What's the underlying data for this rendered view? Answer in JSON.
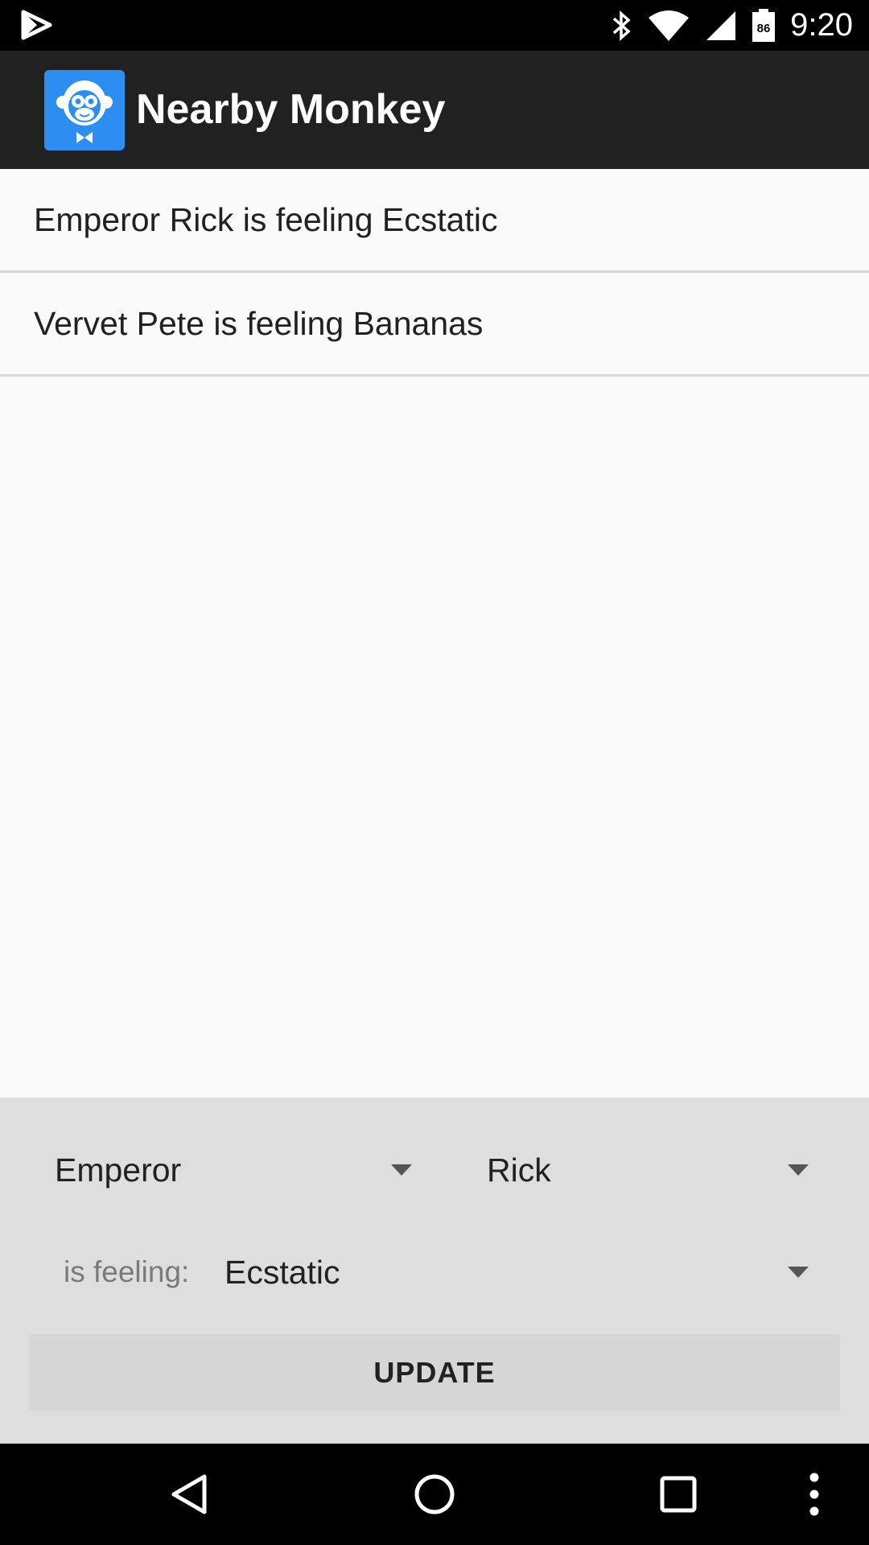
{
  "status_bar": {
    "time": "9:20",
    "battery_level": "86",
    "icons": [
      "play-store-notification-icon",
      "bluetooth-icon",
      "wifi-icon",
      "cell-signal-icon",
      "battery-icon"
    ]
  },
  "app_bar": {
    "title": "Nearby Monkey",
    "logo_icon": "monkey-logo-icon",
    "accent_color": "#2b8ef0"
  },
  "list": {
    "items": [
      {
        "text": "Emperor Rick is feeling Ecstatic"
      },
      {
        "text": "Vervet Pete is feeling Bananas"
      }
    ]
  },
  "form": {
    "species_value": "Emperor",
    "name_value": "Rick",
    "feeling_label": "is feeling:",
    "feeling_value": "Ecstatic",
    "update_label": "UPDATE"
  },
  "nav_bar": {
    "icons": [
      "back-icon",
      "home-icon",
      "recents-icon",
      "overflow-menu-icon"
    ]
  },
  "colors": {
    "app_bar": "#212121",
    "panel": "#dedede",
    "status_bar": "#000000"
  }
}
